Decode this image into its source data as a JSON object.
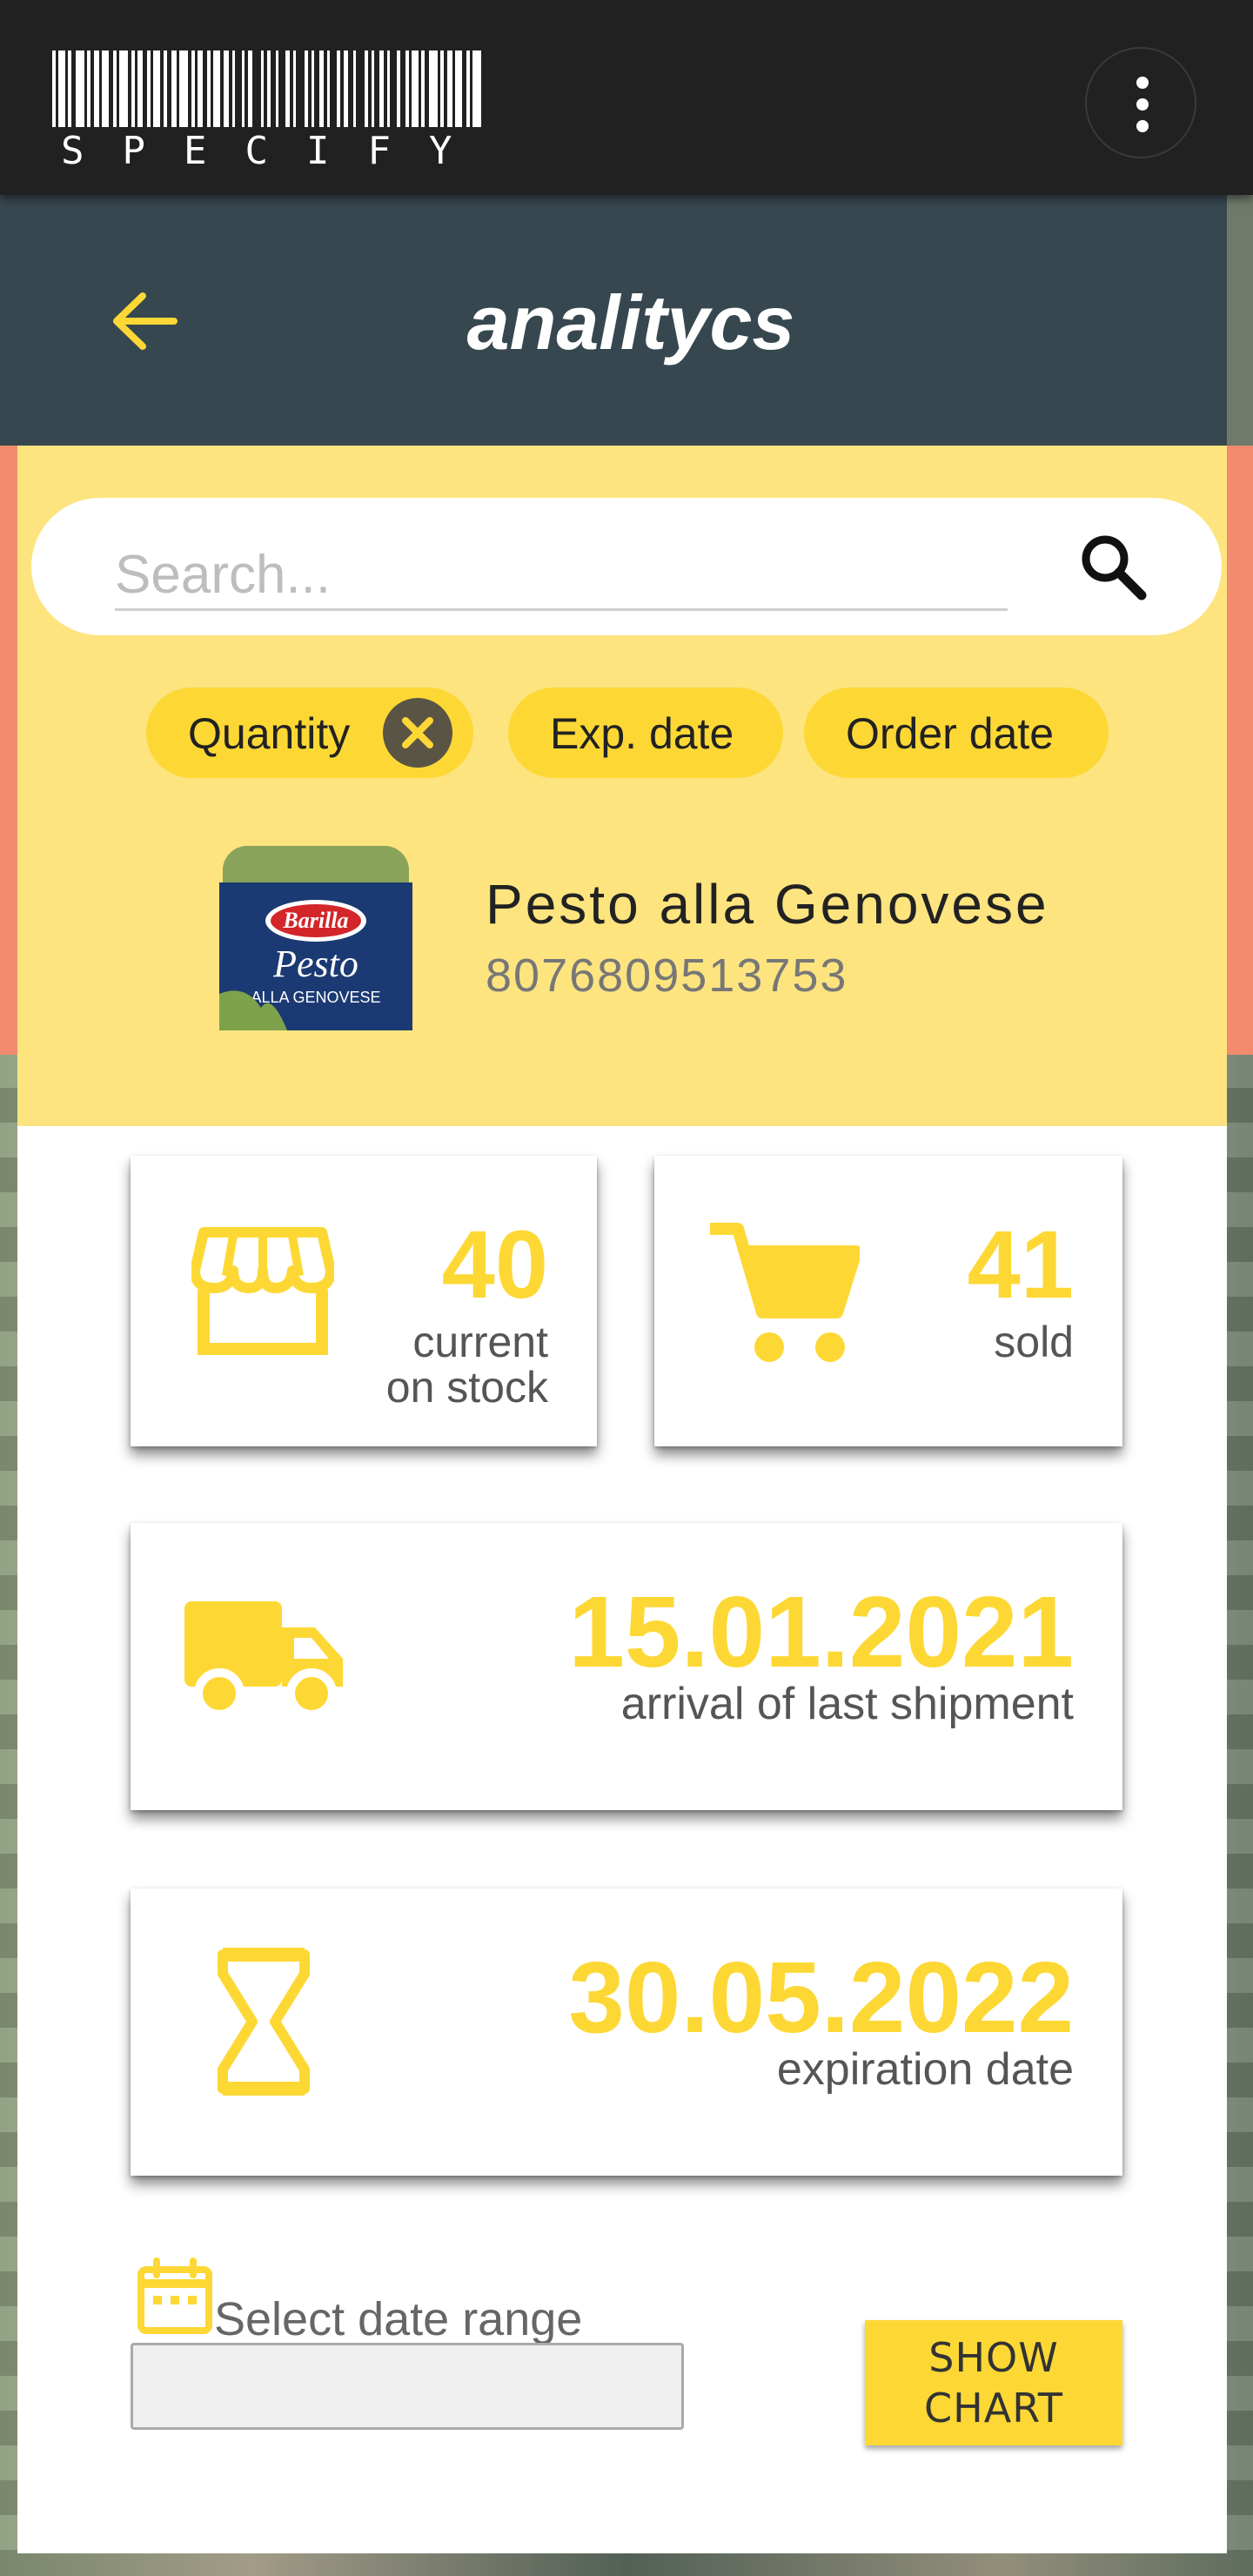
{
  "app": {
    "logo_text": "SPECIFY",
    "page_title": "analitycs"
  },
  "search": {
    "placeholder": "Search...",
    "value": ""
  },
  "filters": [
    {
      "label": "Quantity",
      "active": true
    },
    {
      "label": "Exp. date",
      "active": false
    },
    {
      "label": "Order date",
      "active": false
    }
  ],
  "product": {
    "name": "Pesto alla Genovese",
    "barcode": "8076809513753",
    "thumb_brand": "Barilla",
    "thumb_title": "Pesto",
    "thumb_sub": "ALLA GENOVESE"
  },
  "stats": {
    "stock": {
      "value": "40",
      "label_line1": "current",
      "label_line2": "on stock",
      "icon": "store-icon"
    },
    "sold": {
      "value": "41",
      "label": "sold",
      "icon": "cart-icon"
    },
    "shipment": {
      "value": "15.01.2021",
      "label": "arrival of last shipment",
      "icon": "truck-icon"
    },
    "expiration": {
      "value": "30.05.2022",
      "label": "expiration date",
      "icon": "hourglass-icon"
    }
  },
  "date_range": {
    "label": "Select date range",
    "value": ""
  },
  "actions": {
    "show_chart_line1": "SHOW",
    "show_chart_line2": "CHART"
  },
  "colors": {
    "accent": "#fdd835",
    "panel_yellow": "#fde47f",
    "appbar": "#37474f",
    "topbar": "#212121"
  }
}
